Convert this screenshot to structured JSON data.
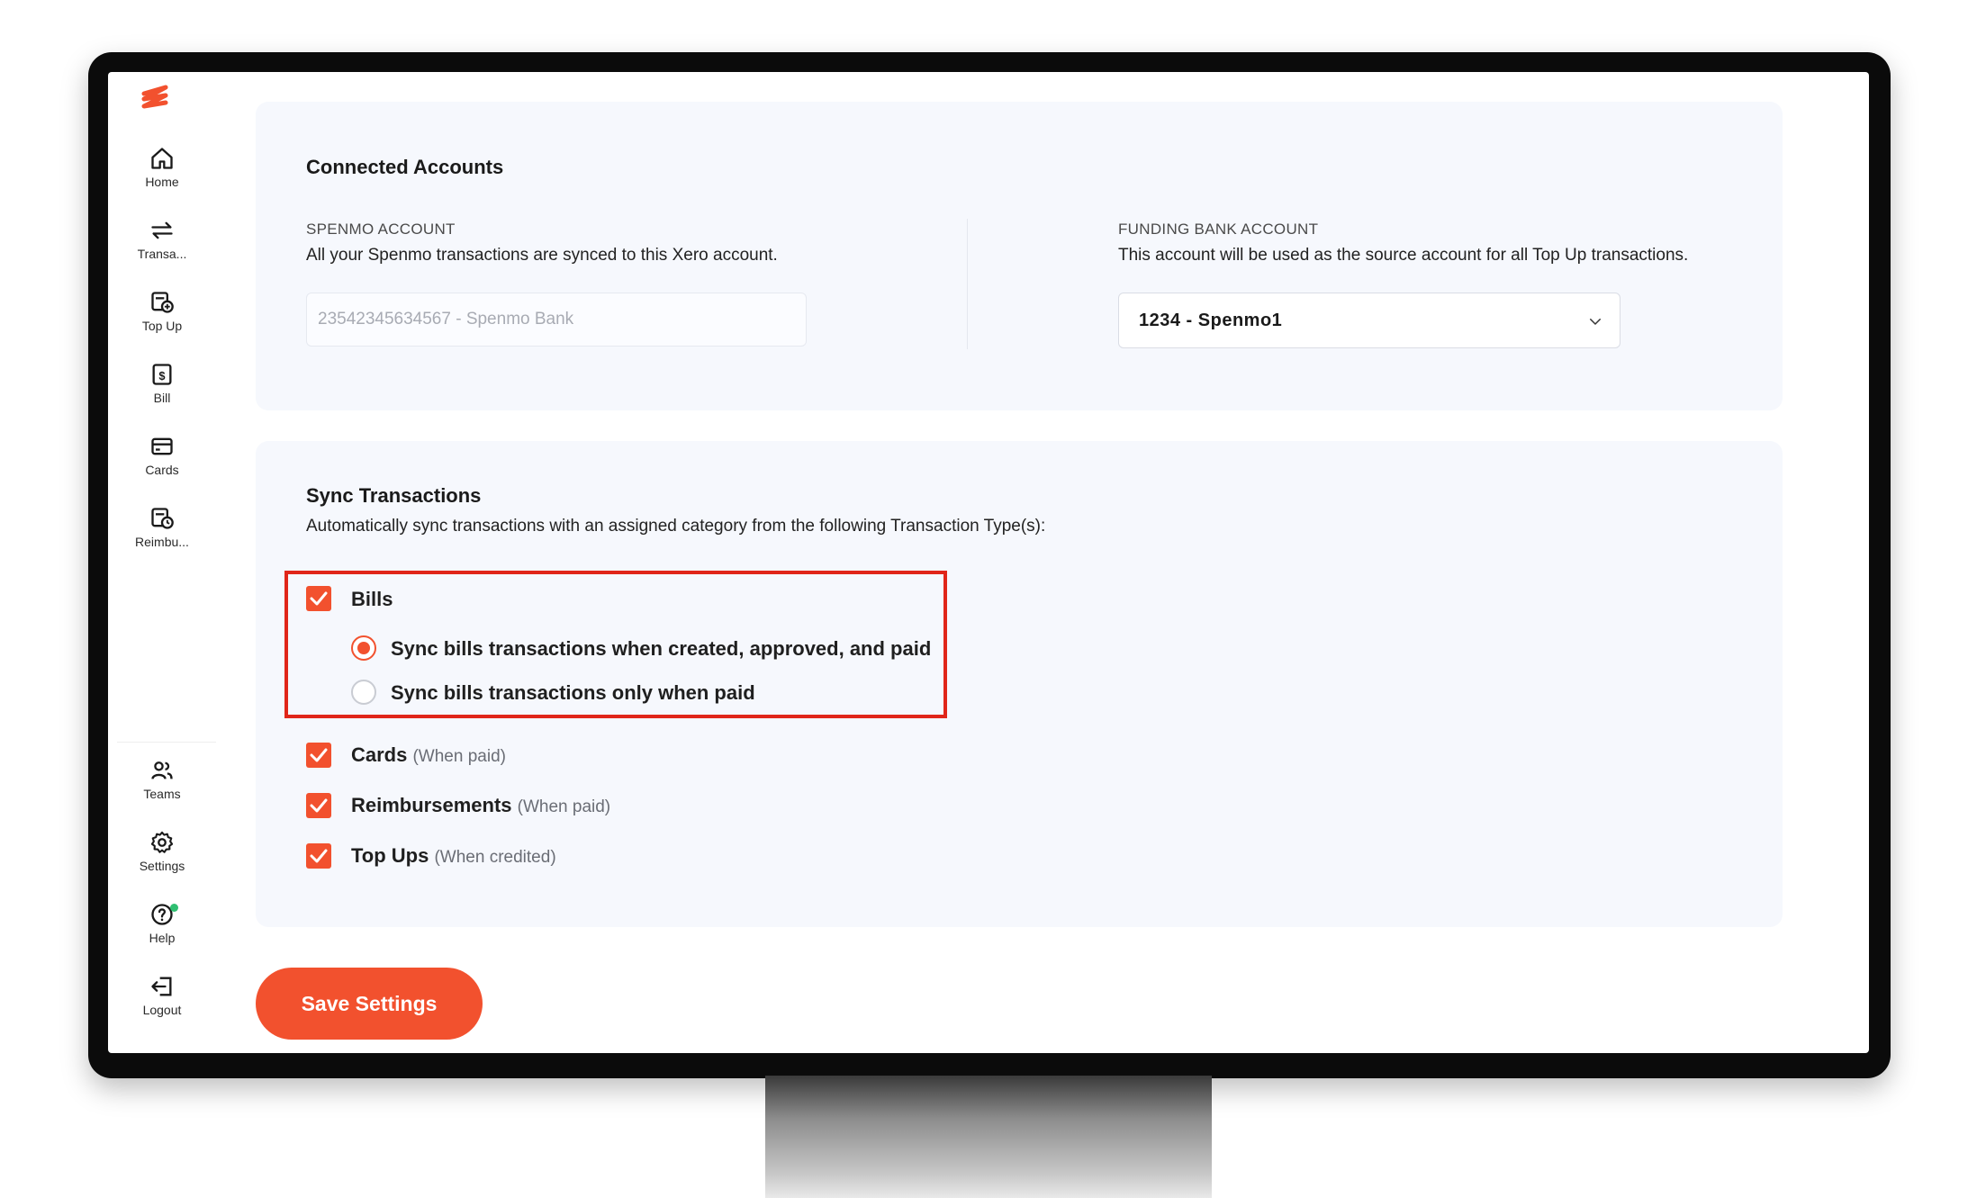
{
  "sidebar": {
    "items": [
      {
        "label": "Home",
        "icon": "home-icon"
      },
      {
        "label": "Transa...",
        "icon": "arrows-exchange-icon"
      },
      {
        "label": "Top Up",
        "icon": "wallet-topup-icon"
      },
      {
        "label": "Bill",
        "icon": "bill-icon"
      },
      {
        "label": "Cards",
        "icon": "card-icon"
      },
      {
        "label": "Reimbu...",
        "icon": "reimbursement-icon"
      }
    ],
    "bottom_items": [
      {
        "label": "Teams",
        "icon": "users-icon"
      },
      {
        "label": "Settings",
        "icon": "gear-icon"
      },
      {
        "label": "Help",
        "icon": "help-icon"
      },
      {
        "label": "Logout",
        "icon": "logout-icon"
      }
    ]
  },
  "connected_accounts": {
    "title": "Connected Accounts",
    "spenmo_account": {
      "label": "SPENMO ACCOUNT",
      "description": "All your Spenmo transactions are synced to this Xero account.",
      "value": "23542345634567 - Spenmo Bank"
    },
    "funding_bank_account": {
      "label": "FUNDING BANK ACCOUNT",
      "description": "This account will be used as the source account for all Top Up transactions.",
      "selected": "1234 - Spenmo1"
    }
  },
  "sync_transactions": {
    "title": "Sync Transactions",
    "description": "Automatically sync transactions with an assigned category from the following Transaction Type(s):",
    "bills": {
      "label": "Bills",
      "checked": true,
      "options": [
        {
          "label": "Sync bills transactions when created, approved, and paid",
          "selected": true
        },
        {
          "label": "Sync bills transactions only when paid",
          "selected": false
        }
      ]
    },
    "types": [
      {
        "label": "Cards",
        "suffix": "(When paid)",
        "checked": true
      },
      {
        "label": "Reimbursements",
        "suffix": "(When paid)",
        "checked": true
      },
      {
        "label": "Top Ups",
        "suffix": "(When credited)",
        "checked": true
      }
    ]
  },
  "save_button_label": "Save Settings",
  "colors": {
    "accent": "#f2512e",
    "highlight": "#e02619",
    "card_background": "#f6f8fd"
  }
}
